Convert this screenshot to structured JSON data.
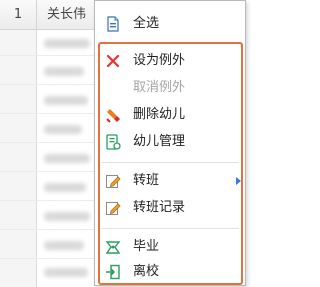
{
  "table": {
    "col_num": "1",
    "col_name": "关长伟"
  },
  "menu": {
    "items": [
      {
        "label": "全选",
        "icon": "select-all-icon"
      },
      {
        "label": "设为例外",
        "icon": "close-x-icon"
      },
      {
        "label": "取消例外",
        "icon": "none"
      },
      {
        "label": "删除幼儿",
        "icon": "delete-child-icon"
      },
      {
        "label": "幼儿管理",
        "icon": "child-management-icon"
      },
      {
        "label": "转班",
        "icon": "edit-pencil-icon"
      },
      {
        "label": "转班记录",
        "icon": "edit-pencil-icon"
      },
      {
        "label": "毕业",
        "icon": "graduation-icon"
      },
      {
        "label": "离校",
        "icon": "exit-door-icon"
      }
    ]
  },
  "colors": {
    "highlight": "#e8703a",
    "submenu_arrow": "#3a7bd5",
    "disabled_text": "#a3a3a3"
  }
}
